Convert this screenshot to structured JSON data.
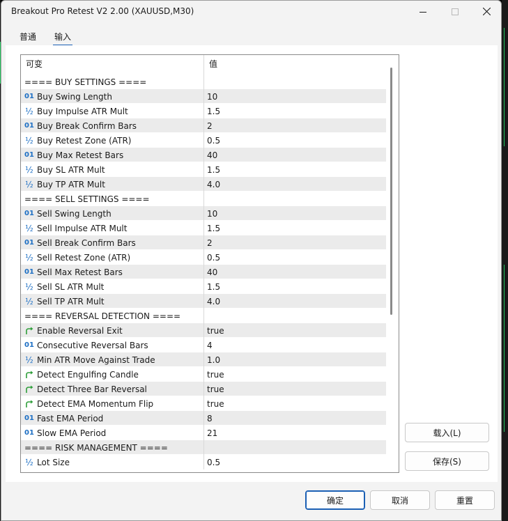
{
  "window": {
    "title": "Breakout Pro Retest V2 2.00 (XAUUSD,M30)"
  },
  "tabs": [
    {
      "label": "普通",
      "active": false
    },
    {
      "label": "输入",
      "active": true
    }
  ],
  "grid": {
    "col_variable": "可变",
    "col_value": "值",
    "rows": [
      {
        "type": "header",
        "name": "==== BUY SETTINGS ====",
        "value": ""
      },
      {
        "type": "int",
        "icon": "01",
        "name": "Buy Swing Length",
        "value": "10"
      },
      {
        "type": "double",
        "icon": "½",
        "name": "Buy Impulse ATR Mult",
        "value": "1.5"
      },
      {
        "type": "int",
        "icon": "01",
        "name": "Buy Break Confirm Bars",
        "value": "2"
      },
      {
        "type": "double",
        "icon": "½",
        "name": "Buy Retest Zone (ATR)",
        "value": "0.5"
      },
      {
        "type": "int",
        "icon": "01",
        "name": "Buy Max Retest Bars",
        "value": "40"
      },
      {
        "type": "double",
        "icon": "½",
        "name": "Buy SL ATR Mult",
        "value": "1.5"
      },
      {
        "type": "double",
        "icon": "½",
        "name": "Buy TP ATR Mult",
        "value": "4.0"
      },
      {
        "type": "header",
        "name": "==== SELL SETTINGS ====",
        "value": ""
      },
      {
        "type": "int",
        "icon": "01",
        "name": "Sell Swing Length",
        "value": "10"
      },
      {
        "type": "double",
        "icon": "½",
        "name": "Sell Impulse ATR Mult",
        "value": "1.5"
      },
      {
        "type": "int",
        "icon": "01",
        "name": "Sell Break Confirm Bars",
        "value": "2"
      },
      {
        "type": "double",
        "icon": "½",
        "name": "Sell Retest Zone (ATR)",
        "value": "0.5"
      },
      {
        "type": "int",
        "icon": "01",
        "name": "Sell Max Retest Bars",
        "value": "40"
      },
      {
        "type": "double",
        "icon": "½",
        "name": "Sell SL ATR Mult",
        "value": "1.5"
      },
      {
        "type": "double",
        "icon": "½",
        "name": "Sell TP ATR Mult",
        "value": "4.0"
      },
      {
        "type": "header",
        "name": "==== REVERSAL DETECTION ====",
        "value": ""
      },
      {
        "type": "bool",
        "icon": "bool",
        "name": "Enable Reversal Exit",
        "value": "true"
      },
      {
        "type": "int",
        "icon": "01",
        "name": "Consecutive Reversal Bars",
        "value": "4"
      },
      {
        "type": "double",
        "icon": "½",
        "name": "Min ATR Move Against Trade",
        "value": "1.0"
      },
      {
        "type": "bool",
        "icon": "bool",
        "name": "Detect Engulfing Candle",
        "value": "true"
      },
      {
        "type": "bool",
        "icon": "bool",
        "name": "Detect Three Bar Reversal",
        "value": "true"
      },
      {
        "type": "bool",
        "icon": "bool",
        "name": "Detect EMA Momentum Flip",
        "value": "true"
      },
      {
        "type": "int",
        "icon": "01",
        "name": "Fast EMA Period",
        "value": "8"
      },
      {
        "type": "int",
        "icon": "01",
        "name": "Slow EMA Period",
        "value": "21"
      },
      {
        "type": "header",
        "name": "==== RISK MANAGEMENT ====",
        "value": ""
      },
      {
        "type": "double",
        "icon": "½",
        "name": "Lot Size",
        "value": "0.5"
      }
    ]
  },
  "side_buttons": {
    "load": "载入(L)",
    "save": "保存(S)"
  },
  "footer_buttons": {
    "ok": "确定",
    "cancel": "取消",
    "reset": "重置"
  },
  "colors": {
    "accent": "#1a5fb4",
    "int_icon": "#1d6fc4",
    "bool_icon": "#2e9e3a",
    "row_alt": "#ebebeb"
  }
}
